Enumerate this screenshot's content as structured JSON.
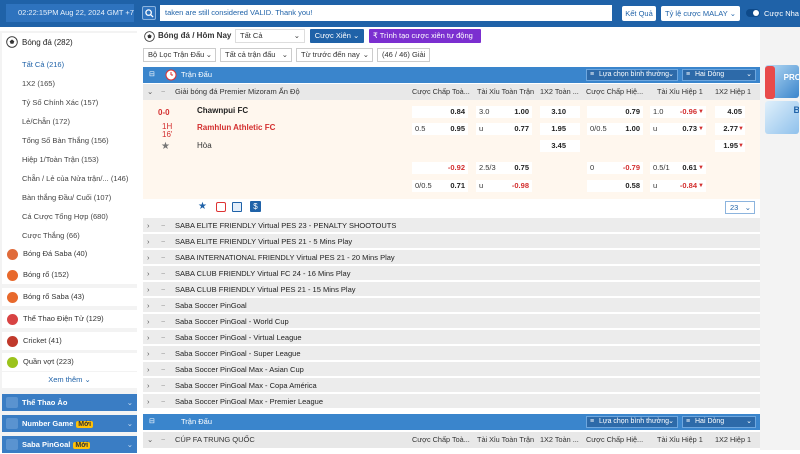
{
  "topbar": {
    "datetime": "02:22:15PM Aug 22, 2024 GMT +7",
    "marquee": "taken are still considered VALID. Thank you!",
    "results_btn": "Kết Quả",
    "odds_select": "Tỷ lệ cược MALAY",
    "toggle_label": "Cược Nha"
  },
  "sidebar": {
    "soccer_label": "Bóng đá",
    "soccer_count": "(282)",
    "subitems": [
      {
        "label": "Tất Cả (216)",
        "active": true
      },
      {
        "label": "1X2 (165)"
      },
      {
        "label": "Tỷ Số Chính Xác (157)"
      },
      {
        "label": "Lẻ/Chẵn (172)"
      },
      {
        "label": "Tổng Số Bàn Thắng (156)"
      },
      {
        "label": "Hiệp 1/Toàn Trận (153)"
      },
      {
        "label": "Chẵn / Lẻ của Nửa trận/...  (146)"
      },
      {
        "label": "Bàn thắng Đầu/ Cuối (107)"
      },
      {
        "label": "Cá Cược Tổng Hợp (680)"
      },
      {
        "label": "Cược Thắng (66)"
      }
    ],
    "sports": [
      {
        "label": "Bóng Đá Saba  (40)",
        "color": "#e06b3a"
      },
      {
        "label": "Bóng rổ (152)",
        "color": "#e8692c"
      },
      {
        "label": "Bóng rổ Saba  (43)",
        "color": "#e8692c"
      },
      {
        "label": "Thể Thao Điện Tử  (129)",
        "color": "#d84343"
      },
      {
        "label": "Cricket  (41)",
        "color": "#c0392b"
      },
      {
        "label": "Quần vợt  (223)",
        "color": "#9bc31c"
      }
    ],
    "more": "Xem thêm",
    "categories": [
      {
        "label": "Thể Thao Ảo",
        "badge": ""
      },
      {
        "label": "Number Game",
        "badge": "Mới"
      },
      {
        "label": "Saba PinGoal",
        "badge": "Mới"
      }
    ]
  },
  "main": {
    "sport_title": "Bóng đá / Hôm Nay",
    "sport_select": "Tất Cả",
    "combo_btn": "Cược Xiên",
    "auto_combo_btn": "Trình tạo cược xiên tự động",
    "filter1": "Bộ Lọc Trận Đấu",
    "filter2": "Tất cả trận đấu",
    "filter3": "Từ trước đến nay",
    "games_count": "(46 / 46) Giải",
    "section_label": "Trận Đấu",
    "sort_label": "Lựa chọn bình thường",
    "view_label": "Hai Dòng",
    "league_name": "Giải bóng đá Premier Mizoram Ấn Độ",
    "col_headers": [
      "Cược Chấp Toà...",
      "Tài Xỉu Toàn Trận",
      "1X2 Toàn ...",
      "Cược Chấp Hiệ...",
      "Tài Xỉu Hiệp 1",
      "1X2 Hiệp 1"
    ],
    "match": {
      "score": "0-0",
      "period": "1H",
      "minute": "16'",
      "home": "Chawnpui FC",
      "away": "Ramhlun Athletic FC",
      "draw": "Hòa",
      "row1": {
        "ft_hdp": "",
        "ft_hdp_odds": "0.84",
        "ft_ou_line": "3.0",
        "ft_ou_odds": "1.00",
        "ft_1x2": "3.10",
        "h1_hdp": "",
        "h1_hdp_odds": "0.79",
        "h1_ou_line": "1.0",
        "h1_ou_odds": "-0.96",
        "h1_1x2": "4.05"
      },
      "row2": {
        "ft_hdp": "0.5",
        "ft_hdp_odds": "0.95",
        "ft_ou_line": "u",
        "ft_ou_odds": "0.77",
        "ft_1x2": "1.95",
        "h1_hdp": "0/0.5",
        "h1_hdp_odds": "1.00",
        "h1_ou_line": "u",
        "h1_ou_odds": "0.73",
        "h1_1x2": "2.77"
      },
      "row3": {
        "ft_1x2": "3.45",
        "h1_1x2": "1.95"
      },
      "alt1": {
        "ft_hdp": "",
        "ft_hdp_odds": "-0.92",
        "ft_ou_line": "2.5/3",
        "ft_ou_odds": "0.75",
        "h1_hdp": "0",
        "h1_hdp_odds": "-0.79",
        "h1_ou_line": "0.5/1",
        "h1_ou_odds": "0.61"
      },
      "alt2": {
        "ft_hdp": "0/0.5",
        "ft_hdp_odds": "0.71",
        "ft_ou_line": "u",
        "ft_ou_odds": "-0.98",
        "h1_hdp": "",
        "h1_hdp_odds": "0.58",
        "h1_ou_line": "u",
        "h1_ou_odds": "-0.84"
      },
      "more_bets": "23"
    },
    "leagues": [
      "SABA ELITE FRIENDLY Virtual PES 23 - PENALTY SHOOTOUTS",
      "SABA ELITE FRIENDLY Virtual PES 21 - 5 Mins Play",
      "SABA INTERNATIONAL FRIENDLY Virtual PES 21 - 20 Mins Play",
      "SABA CLUB FRIENDLY Virtual FC 24 - 16 Mins Play",
      "SABA CLUB FRIENDLY Virtual PES 21 - 15 Mins Play",
      "Saba Soccer PinGoal",
      "Saba Soccer PinGoal - World Cup",
      "Saba Soccer PinGoal - Virtual League",
      "Saba Soccer PinGoal - Super League",
      "Saba Soccer PinGoal Max - Asian Cup",
      "Saba Soccer PinGoal Max - Copa América",
      "Saba Soccer PinGoal Max - Premier League"
    ],
    "section2_label": "Trận Đấu",
    "league2_name": "CÚP FA TRUNG QUỐC"
  },
  "colors": {
    "brand": "#1f62a8",
    "section": "#3a85cc",
    "purple": "#7b2fd0",
    "negative": "#d32f2f"
  }
}
